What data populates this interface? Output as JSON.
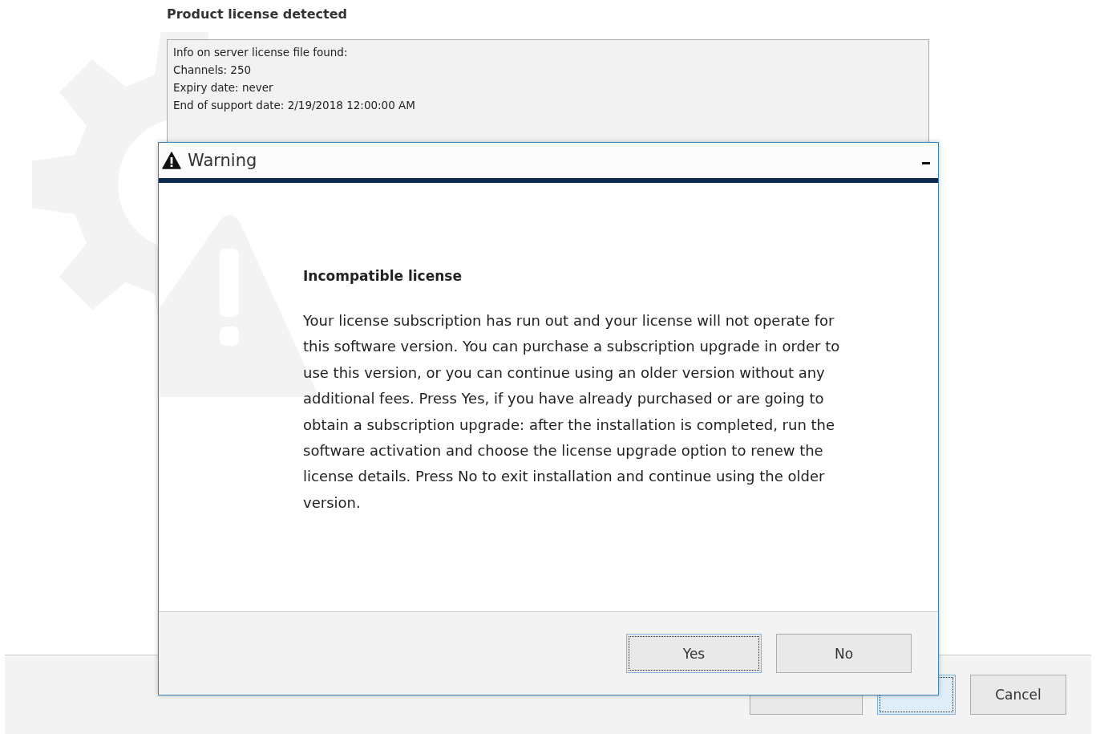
{
  "page": {
    "title": "Product license detected",
    "info_lines": [
      "Info on server license file found:",
      "Channels: 250",
      "Expiry date: never",
      "End of support date: 2/19/2018 12:00:00 AM"
    ]
  },
  "footer": {
    "buttons": [
      {
        "focused": false
      },
      {
        "focused": true
      },
      {
        "label": "Cancel",
        "focused": false
      }
    ]
  },
  "dialog": {
    "title": "Warning",
    "heading": "Incompatible license",
    "message": "Your license subscription has run out and your license will not operate for this software version. You can purchase a subscription upgrade in order to use this version, or you can continue using an older version without any additional fees. Press Yes, if you have already purchased or are going to obtain a subscription upgrade: after the installation is completed, run the software activation and choose the license upgrade option to renew the license details. Press No to exit installation and continue using the older version.",
    "buttons": [
      {
        "label": "Yes",
        "focused": true
      },
      {
        "label": "No",
        "focused": false
      }
    ]
  }
}
